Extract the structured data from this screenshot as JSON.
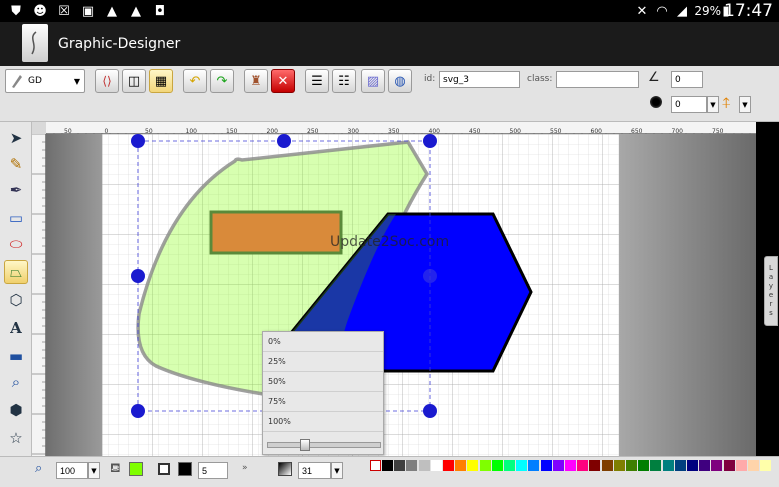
{
  "statusbar": {
    "left_icons": [
      "shield-icon",
      "mask-icon",
      "cancel-x-icon",
      "image-icon",
      "warning-icon",
      "warning-icon",
      "bag-icon"
    ],
    "battery": "29%",
    "time": "17:47"
  },
  "app": {
    "title": "Graphic-Designer"
  },
  "toolbar": {
    "gd_select": "GD",
    "id_label": "id:",
    "id_value": "svg_3",
    "class_label": "class:",
    "class_value": "",
    "angle_value": "0",
    "blur_value": "0"
  },
  "ruler": {
    "marks": [
      "50",
      "0",
      "50",
      "100",
      "150",
      "200",
      "250",
      "300",
      "350",
      "400",
      "450",
      "500",
      "550",
      "600",
      "650",
      "700",
      "750"
    ]
  },
  "canvas": {
    "watermark": "Update2Soc.com"
  },
  "opacity_menu": {
    "options": [
      "0%",
      "25%",
      "50%",
      "75%",
      "100%"
    ]
  },
  "layers_tab": {
    "letters": [
      "L",
      "a",
      "y",
      "e",
      "r",
      "s"
    ]
  },
  "bottombar": {
    "zoom": "100",
    "stroke_width": "5",
    "opacity": "31"
  },
  "colors": {
    "fill": "#7fff00",
    "stroke": "#000000",
    "palette": [
      "#000000",
      "#3f3f3f",
      "#7f7f7f",
      "#bfbfbf",
      "#ffffff",
      "#ff0000",
      "#ff7f00",
      "#ffff00",
      "#7fff00",
      "#00ff00",
      "#00ff7f",
      "#00ffff",
      "#007fff",
      "#0000ff",
      "#7f00ff",
      "#ff00ff",
      "#ff007f",
      "#7f0000",
      "#7f3f00",
      "#7f7f00",
      "#3f7f00",
      "#007f00",
      "#007f3f",
      "#007f7f",
      "#003f7f",
      "#00007f",
      "#3f007f",
      "#7f007f",
      "#7f003f",
      "#ffaaaa",
      "#ffd4aa",
      "#ffffaa"
    ]
  }
}
